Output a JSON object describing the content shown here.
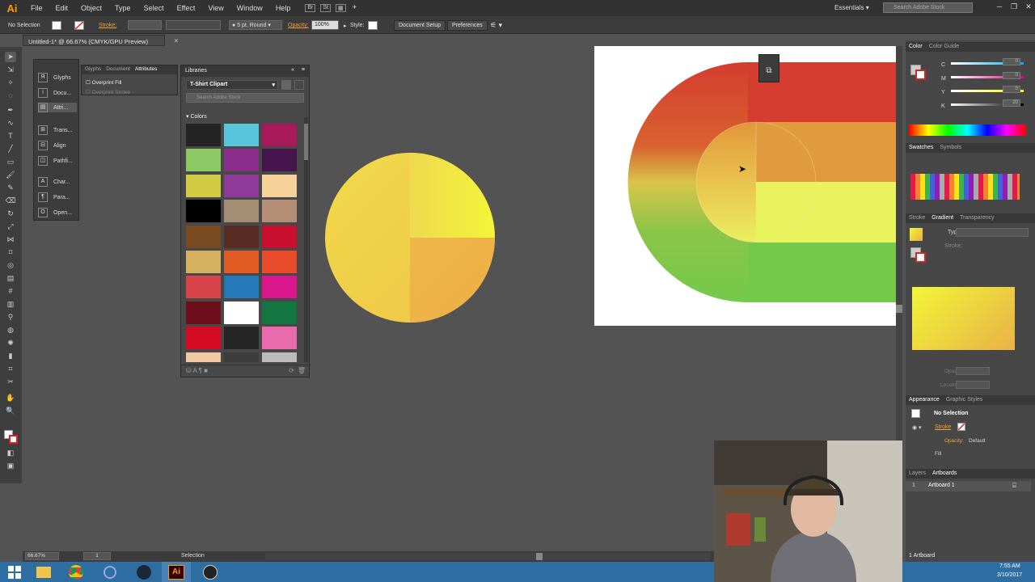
{
  "app": {
    "logo": "Ai"
  },
  "menu": [
    "File",
    "Edit",
    "Object",
    "Type",
    "Select",
    "Effect",
    "View",
    "Window",
    "Help"
  ],
  "bridge_buttons": [
    "Br",
    "St"
  ],
  "workspace": "Essentials",
  "stock_search_placeholder": "Search Adobe Stock",
  "control": {
    "selection": "No Selection",
    "stroke_label": "Stroke:",
    "brush": "5 pt. Round",
    "opacity_label": "Opacity:",
    "opacity_value": "100%",
    "style_label": "Style:",
    "doc_setup": "Document Setup",
    "preferences": "Preferences"
  },
  "document_tab": "Untitled-1* @ 66.67% (CMYK/GPU Preview)",
  "left_panel": {
    "items": [
      "Glyphs",
      "Docu...",
      "Attri...",
      "Trans...",
      "Align",
      "Pathfi...",
      "Char...",
      "Para...",
      "Open..."
    ]
  },
  "attributes_panel": {
    "tabs": [
      "Glyphs",
      "Document",
      "Attributes"
    ],
    "overprint_fill": "Overprint Fill",
    "overprint_stroke": "Overprint Stroke"
  },
  "libraries": {
    "title": "Libraries",
    "library": "T-Shirt Clipart",
    "search_placeholder": "Search Adobe Stock",
    "section": "Colors",
    "colors": [
      "#242424",
      "#59c5dc",
      "#a8195a",
      "#8cc863",
      "#8c2e8c",
      "#46154e",
      "#d4cb44",
      "#8e3a9a",
      "#f6d29a",
      "#000000",
      "#a58c74",
      "#b38e74",
      "#7a4a21",
      "#5a2d24",
      "#c8102e",
      "#d4b060",
      "#e25b24",
      "#e84c2a",
      "#d9434a",
      "#2579bb",
      "#d9168b",
      "#6d0e1c",
      "#ffffff",
      "#137540",
      "#d40a22",
      "#252525",
      "#ea6aae",
      "#f0c8a4",
      "#3c3c3c",
      "#bcbcbc"
    ]
  },
  "right_panel": {
    "color_tabs": [
      "Color",
      "Color Guide"
    ],
    "cmyk": [
      {
        "label": "C",
        "value": "0"
      },
      {
        "label": "M",
        "value": "0"
      },
      {
        "label": "Y",
        "value": "0"
      },
      {
        "label": "K",
        "value": "20"
      }
    ],
    "swatch_tabs": [
      "Swatches",
      "Symbols"
    ],
    "gradient_tabs": [
      "Stroke",
      "Gradient",
      "Transparency"
    ],
    "type_label": "Type:",
    "stroke_label": "Stroke:",
    "opacity_label": "Opacity:",
    "location_label": "Location:",
    "appearance_tabs": [
      "Appearance",
      "Graphic Styles"
    ],
    "appearance_title": "No Selection",
    "appearance_stroke": "Stroke",
    "appearance_opacity": "Opacity:",
    "appearance_opacity_value": "Default",
    "appearance_fill": "Fill",
    "layers_tabs": [
      "Layers",
      "Artboards"
    ],
    "artboard_index": "1",
    "artboard_name": "Artboard 1",
    "artboard_count": "1 Artboard"
  },
  "status": {
    "zoom": "66.67%",
    "page": "1",
    "tool": "Selection"
  },
  "clock": {
    "time": "7:55 AM",
    "date": "3/10/2017"
  },
  "colors": {
    "accent": "#ff9a00",
    "red": "#d43d2f",
    "orange": "#e29b3c",
    "yellow": "#e9f35e",
    "green": "#74c94a"
  }
}
